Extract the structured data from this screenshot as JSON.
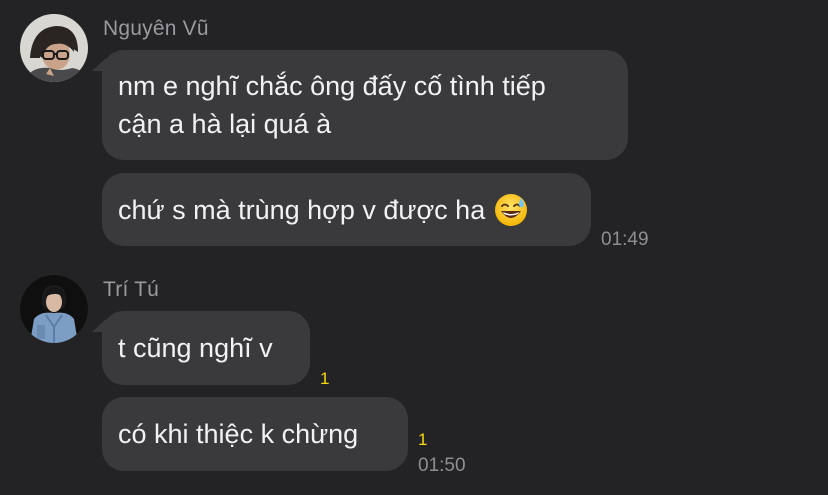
{
  "groups": [
    {
      "sender": "Nguyên Vũ",
      "avatar_icon": "user-avatar-glasses-icon",
      "messages": [
        {
          "lines": [
            "nm e nghĩ chắc ông đấy cố tình tiếp",
            "cận a hà lại quá à"
          ]
        },
        {
          "text": "chứ s mà trùng hợp v được ha",
          "emoji": "grinning-face-with-sweat-icon"
        }
      ],
      "time": "01:49"
    },
    {
      "sender": "Trí Tú",
      "avatar_icon": "user-avatar-denim-icon",
      "messages": [
        {
          "text": "t cũng nghĩ v",
          "seen_count": "1"
        },
        {
          "text": "có khi thiệc k chừng",
          "seen_count": "1"
        }
      ],
      "time": "01:50"
    }
  ],
  "colors": {
    "background": "#232325",
    "bubble": "#3a3a3c",
    "text": "#f2f2f4",
    "sender_name": "#9a9a9e",
    "timestamp": "#8e8e93",
    "seen_indicator": "#f5d90a"
  }
}
